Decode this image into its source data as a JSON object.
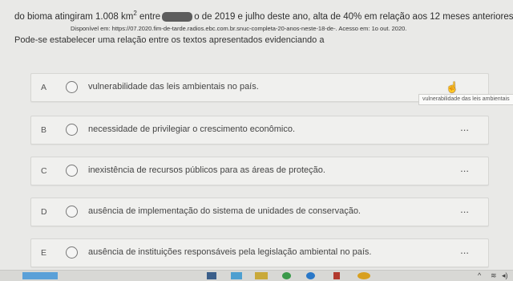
{
  "header": {
    "line_before_sup": "do bioma atingiram 1.008 km",
    "sup": "2",
    "line_mid": " entre",
    "line_after": "o de 2019 e julho deste ano, alta de 40% em relação aos 12 meses anteriores.",
    "source": "Disponível em: https://07.2020.fim-de-tarde.radios.ebc.com.br.snuc-completa-20-anos-neste-18-de-. Acesso em: 1o out. 2020.",
    "question": "Pode-se estabelecer uma relação entre os textos apresentados evidenciando a"
  },
  "options": [
    {
      "letter": "A",
      "text": "vulnerabilidade das leis ambientais no país."
    },
    {
      "letter": "B",
      "text": "necessidade de privilegiar o crescimento econômico."
    },
    {
      "letter": "C",
      "text": "inexistência de recursos públicos para as áreas de proteção."
    },
    {
      "letter": "D",
      "text": "ausência de implementação do sistema de unidades de conservação."
    },
    {
      "letter": "E",
      "text": "ausência de instituições responsáveis pela legislação ambiental no país."
    }
  ],
  "more_label": "...",
  "tooltip": "vulnerabilidade das leis ambientais",
  "colors": {
    "background": "#e9e9e7",
    "card": "#f0f0ee",
    "taskbar": "#d8d8d5"
  },
  "taskbar_icons": [
    "windows-start-icon",
    "file-explorer-icon",
    "store-icon",
    "chrome-icon",
    "edge-icon",
    "app-icon",
    "paint-icon"
  ]
}
